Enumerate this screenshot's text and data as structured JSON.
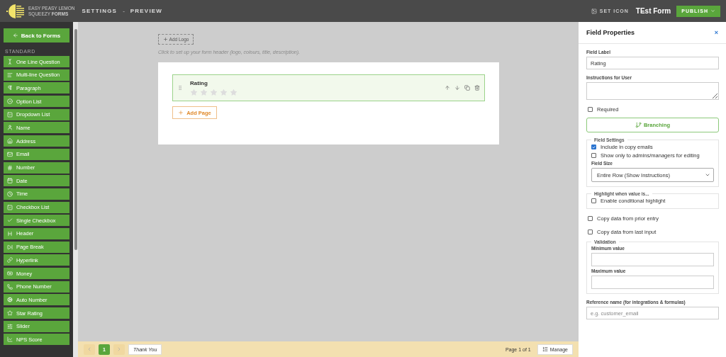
{
  "topbar": {
    "brand_line1": "EASY PEASY LEMON",
    "brand_line2": "SQUEEZY",
    "brand_line3": "FORMS",
    "nav": [
      {
        "label": "SETTINGS"
      },
      {
        "label": "PREVIEW"
      }
    ],
    "separator": "-",
    "set_icon": "SET ICON",
    "form_name": "TEst Form",
    "publish": "PUBLISH"
  },
  "sidebar": {
    "back": "Back to Forms",
    "section": "STANDARD",
    "items": [
      {
        "label": "One Line Question"
      },
      {
        "label": "Multi-line Question"
      },
      {
        "label": "Paragraph"
      },
      {
        "label": "Option List"
      },
      {
        "label": "Dropdown List"
      },
      {
        "label": "Name"
      },
      {
        "label": "Address"
      },
      {
        "label": "Email"
      },
      {
        "label": "Number"
      },
      {
        "label": "Date"
      },
      {
        "label": "Time"
      },
      {
        "label": "Checkbox List"
      },
      {
        "label": "Single Checkbox"
      },
      {
        "label": "Header"
      },
      {
        "label": "Page Break"
      },
      {
        "label": "Hyperlink"
      },
      {
        "label": "Money"
      },
      {
        "label": "Phone Number"
      },
      {
        "label": "Auto Number"
      },
      {
        "label": "Star Rating"
      },
      {
        "label": "Slider"
      },
      {
        "label": "NPS Score"
      }
    ]
  },
  "canvas": {
    "add_logo": "Add Logo",
    "header_hint": "Click to set up your form header (logo, colours, title, description).",
    "field": {
      "label": "Rating",
      "stars": 0,
      "selected": true
    },
    "add_page": "Add Page"
  },
  "footer": {
    "pages": [
      {
        "label": "1",
        "selected": true
      }
    ],
    "thank_you": "Thank You",
    "page_info": "Page 1 of 1",
    "manage": "Manage"
  },
  "properties": {
    "title": "Field Properties",
    "close": "×",
    "field_label": "Field Label",
    "field_label_value": "Rating",
    "instructions": "Instructions for User",
    "required": {
      "label": "Required",
      "checked": false
    },
    "branching": "Branching",
    "field_settings": {
      "legend": "Field Settings",
      "options": [
        {
          "label": "Include in copy emails",
          "checked": true
        },
        {
          "label": "Show only to admins/managers for editing",
          "checked": false
        }
      ],
      "size_label": "Field Size",
      "size_value": "Entire Row (Show Instructions)"
    },
    "highlight": {
      "legend": "Highlight when value is...",
      "option": {
        "label": "Enable conditional highlight",
        "checked": false
      }
    },
    "copy_options": [
      {
        "label": "Copy data from prior entry",
        "checked": false
      },
      {
        "label": "Copy data from last input",
        "checked": false
      }
    ],
    "validation": {
      "legend": "Validation",
      "min_label": "Minimum value",
      "max_label": "Maximum value"
    },
    "reference_label": "Reference name (for integrations & formulas)",
    "reference_placeholder": "e.g. customer_email"
  }
}
